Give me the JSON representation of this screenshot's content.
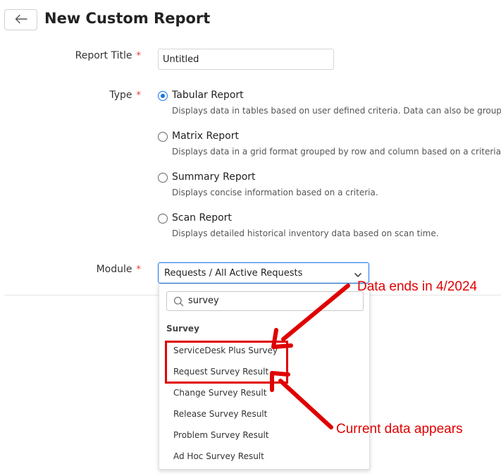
{
  "header": {
    "title": "New Custom Report"
  },
  "form": {
    "report_title": {
      "label": "Report Title",
      "required_mark": "*",
      "value": "Untitled"
    },
    "type": {
      "label": "Type",
      "required_mark": "*",
      "options": [
        {
          "label": "Tabular Report",
          "description": "Displays data in tables based on user defined criteria. Data can also be grouped b",
          "checked": true
        },
        {
          "label": "Matrix Report",
          "description": "Displays data in a grid format grouped by row and column based on a criteria.",
          "checked": false
        },
        {
          "label": "Summary Report",
          "description": "Displays concise information based on a criteria.",
          "checked": false
        },
        {
          "label": "Scan Report",
          "description": "Displays detailed historical inventory data based on scan time.",
          "checked": false
        }
      ]
    },
    "module": {
      "label": "Module",
      "required_mark": "*",
      "value": "Requests / All Active Requests"
    }
  },
  "dropdown": {
    "search_value": "survey",
    "group_heading": "Survey",
    "options": [
      "ServiceDesk Plus Survey",
      "Request Survey Result",
      "Change Survey Result",
      "Release Survey Result",
      "Problem Survey Result",
      "Ad Hoc Survey Result"
    ]
  },
  "annotations": {
    "top": "Data ends in 4/2024",
    "bottom": "Current data appears",
    "color": "#e00000"
  },
  "colors": {
    "accent": "#1a73e8",
    "required": "#e53935"
  }
}
